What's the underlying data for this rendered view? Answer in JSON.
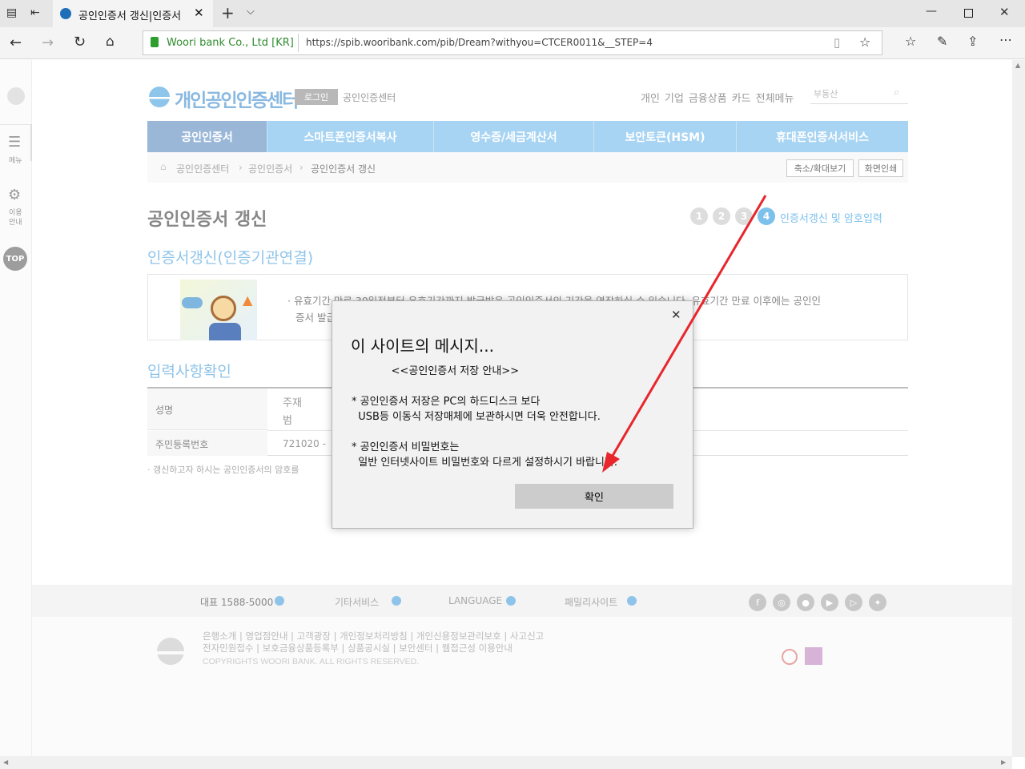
{
  "browser": {
    "tab_title": "공인인증서 갱신|인증서",
    "address_identity": "Woori bank Co., Ltd [KR]",
    "address_url": "https://spib.wooribank.com/pib/Dream?withyou=CTCER0011&__STEP=4"
  },
  "sidebar": {
    "menu_label": "메뉴",
    "usage_label_1": "이용",
    "usage_label_2": "안내",
    "top_label": "TOP"
  },
  "header": {
    "logo_text": "개인공인인증센터",
    "login_button": "로그인",
    "site_label": "공인인증센터",
    "nav_links": [
      "개인",
      "기업",
      "금융상품",
      "카드",
      "전체메뉴"
    ],
    "search_placeholder": "부동산"
  },
  "gnb": {
    "items": [
      "공인인증서",
      "스마트폰인증서복사",
      "영수증/세금계산서",
      "보안토큰(HSM)",
      "휴대폰인증서서비스"
    ]
  },
  "breadcrumb": {
    "items": [
      "공인인증센터",
      "공인인증서",
      "공인인증서 갱신"
    ],
    "zoom_button": "축소/확대보기",
    "print_button": "화면인쇄"
  },
  "page": {
    "title": "공인인증서 갱신",
    "steps": [
      "1",
      "2",
      "3",
      "4"
    ],
    "current_step_label": "인증서갱신 및 암호입력",
    "section1_title": "인증서갱신(인증기관연결)",
    "notice_text_1": "· 유효기간 만료 30일전부터 유효기간까지 발급받은 공인인증서의 기간을 연장하실 수 있습니다. 유효기간 만료 이후에는 공인인",
    "notice_text_2": "증서 발급",
    "section2_title": "입력사항확인",
    "rows": [
      {
        "label": "성명",
        "value_1": "주재",
        "value_2": "범"
      },
      {
        "label": "주민등록번호",
        "value_1": "721020 -",
        "value_2": ""
      }
    ],
    "hint": "· 갱신하고자 하시는 공인인증서의 암호를"
  },
  "dialog": {
    "title": "이 사이트의 메시지...",
    "message": "            <<공인인증서 저장 안내>>\n\n* 공인인증서 저장은 PC의 하드디스크 보다\n  USB등 이동식 저장매체에 보관하시면 더욱 안전합니다.\n\n* 공인인증서 비밀번호는\n  일반 인터넷사이트 비밀번호와 다르게 설정하시기 바랍니다.",
    "ok_button": "확인"
  },
  "footer": {
    "phone": "대표 1588-5000",
    "other_services": "기타서비스",
    "language": "LANGUAGE",
    "family_sites": "패밀리사이트",
    "links_row1": "은행소개 | 영업점안내 | 고객광장 | 개인정보처리방침 | 개인신용정보관리보호 | 사고신고",
    "links_row2": "전자민원접수 | 보호금융상품등록부 | 상품공시실 | 보안센터 | 웹접근성 이용안내",
    "copyright": "COPYRIGHTS WOORI BANK. ALL RIGHTS RESERVED."
  },
  "colors": {
    "accent": "#a8d4f3",
    "annotation_arrow": "#e8262b"
  }
}
